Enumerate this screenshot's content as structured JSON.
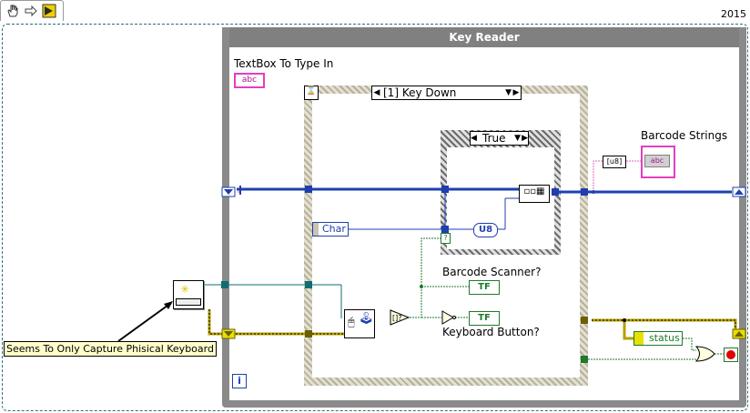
{
  "version": "2015",
  "loop": {
    "title": "Key Reader"
  },
  "controls": {
    "textbox_label": "TextBox To Type In",
    "textbox_glyph": "abc",
    "barcode_strings_label": "Barcode Strings",
    "barcode_strings_glyph": "abc"
  },
  "event_structure": {
    "selector": "[1] Key Down",
    "char_label": "Char"
  },
  "case_structure": {
    "selector": "True",
    "u8_label": "U8"
  },
  "indicators": {
    "barcode_scanner": "Barcode Scanner?",
    "keyboard_button": "Keyboard Button?",
    "tf": "TF",
    "status": "status",
    "question_mark": "?"
  },
  "comment": "Seems To Only Capture Phisical Keyboard",
  "icons": [
    "hand-tool-icon",
    "arrow-run-icon",
    "run-continuous-icon",
    "info-icon",
    "stop-icon"
  ],
  "colors": {
    "string_wire": "#e060c0",
    "numeric_wire": "#1f3fb0",
    "bool_wire": "#1e7a2c",
    "error_wire": "#b4a000",
    "ref_wire": "#0f6e72"
  }
}
